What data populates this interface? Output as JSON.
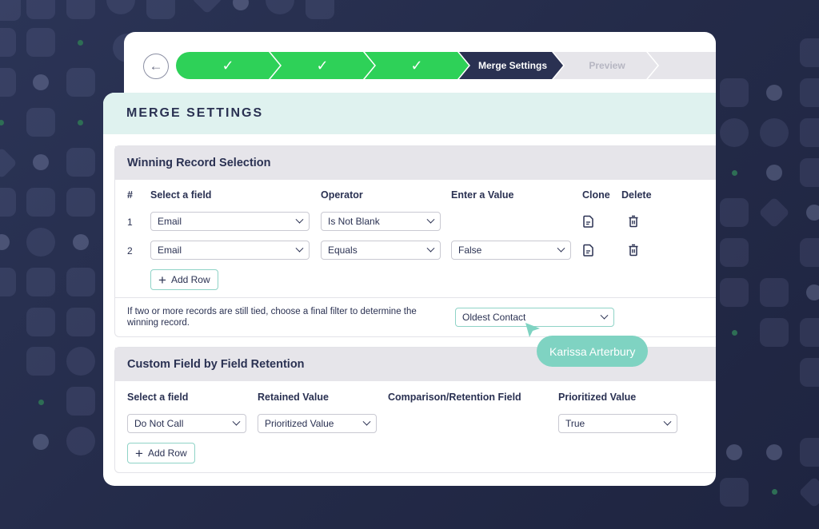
{
  "stepper": {
    "back_icon": "arrow-left-icon",
    "steps": [
      {
        "state": "done",
        "icon": "checkmark-icon",
        "glyph": "✓"
      },
      {
        "state": "done",
        "icon": "checkmark-icon",
        "glyph": "✓"
      },
      {
        "state": "done",
        "icon": "checkmark-icon",
        "glyph": "✓"
      },
      {
        "state": "active",
        "label": "Merge Settings"
      },
      {
        "state": "todo",
        "label": "Preview"
      },
      {
        "state": "todo",
        "label": ""
      }
    ]
  },
  "panel": {
    "title": "MERGE SETTINGS"
  },
  "winning": {
    "title": "Winning Record Selection",
    "headers": {
      "num": "#",
      "field": "Select a field",
      "operator": "Operator",
      "value": "Enter a Value",
      "clone": "Clone",
      "delete": "Delete"
    },
    "rows": [
      {
        "num": "1",
        "field": "Email",
        "operator": "Is Not Blank",
        "value": null
      },
      {
        "num": "2",
        "field": "Email",
        "operator": "Equals",
        "value": "False"
      }
    ],
    "add_row_label": "Add Row",
    "tie_text": "If two or more records are still tied, choose a final filter to determine the winning record.",
    "tie_filter_value": "Oldest Contact"
  },
  "retention": {
    "title": "Custom Field by Field Retention",
    "headers": {
      "field": "Select a field",
      "retained": "Retained Value",
      "comparison": "Comparison/Retention Field",
      "prioritized": "Prioritized Value"
    },
    "rows": [
      {
        "field": "Do Not Call",
        "retained": "Prioritized Value",
        "prioritized": "True"
      }
    ],
    "add_row_label": "Add Row"
  },
  "collaborator_cursor": {
    "name": "Karissa Arterbury",
    "color": "#7fd3c2"
  },
  "colors": {
    "navy": "#2a3152",
    "green": "#2ed158",
    "teal_header": "#dff2ef",
    "section_gray": "#e6e5ea"
  }
}
